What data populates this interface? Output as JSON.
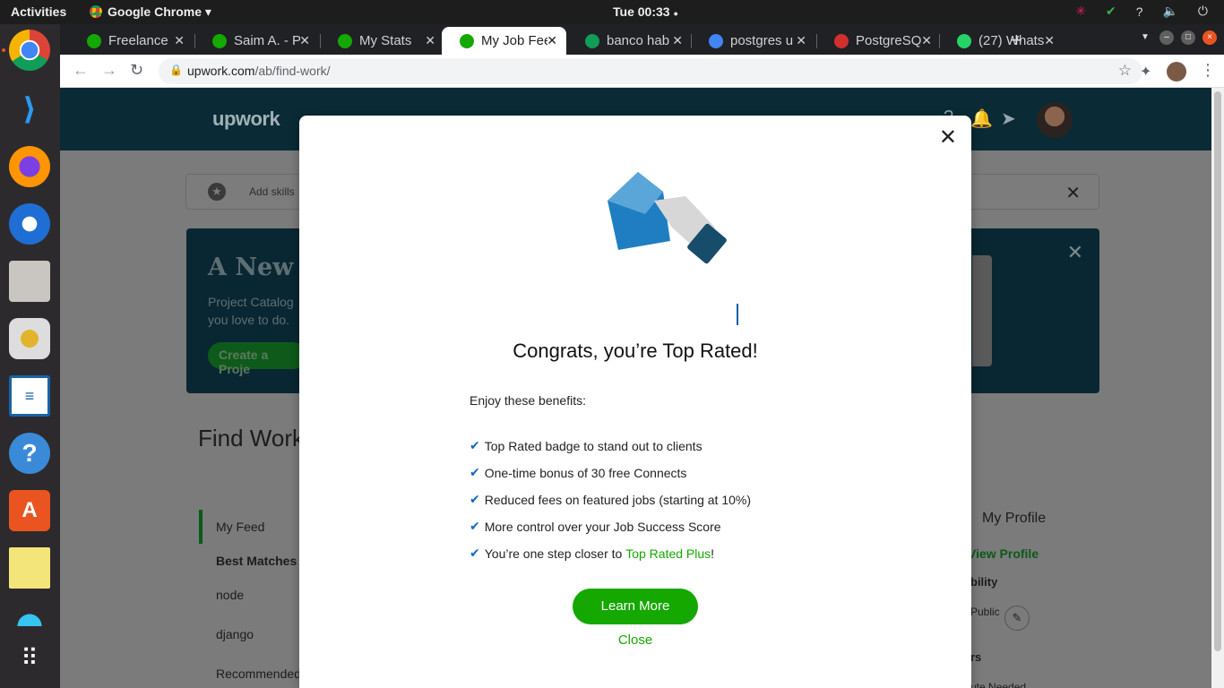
{
  "topbar": {
    "activities": "Activities",
    "app_name": "Google Chrome",
    "clock": "Tue 00:33",
    "tray": [
      "?",
      "🔈",
      "⏻"
    ]
  },
  "browser": {
    "tabs": [
      {
        "label": "Freelance",
        "favicon": "upwork-icon",
        "color": "#14a800",
        "active": false
      },
      {
        "label": "Saim A. - Py",
        "favicon": "upwork-icon",
        "color": "#14a800",
        "active": false
      },
      {
        "label": "My Stats",
        "favicon": "upwork-icon",
        "color": "#14a800",
        "active": false
      },
      {
        "label": "My Job Fee",
        "favicon": "upwork-icon",
        "color": "#14a800",
        "active": true
      },
      {
        "label": "banco hab",
        "favicon": "sheets-icon",
        "color": "#0f9d58",
        "active": false
      },
      {
        "label": "postgres u",
        "favicon": "google-icon",
        "color": "#4285f4",
        "active": false
      },
      {
        "label": "PostgreSQ",
        "favicon": "postgres-icon",
        "color": "#d32f2f",
        "active": false
      },
      {
        "label": "(27) Whats",
        "favicon": "whatsapp-icon",
        "color": "#25d366",
        "active": false
      }
    ],
    "url_host": "upwork.com",
    "url_path": "/ab/find-work/"
  },
  "page": {
    "logo": "upwork",
    "skills_text": "Add skills",
    "banner_title": "A New W",
    "banner_sub": "Project Catalog you love to do.",
    "banner_cta": "Create a Proje",
    "find_work": "Find Work",
    "feed_items": [
      "My Feed",
      "Best Matches",
      "node",
      "django",
      "Recommended"
    ],
    "my_profile": "My Profile",
    "view_profile": "View Profile",
    "visibility": "bility",
    "public": "Public",
    "rs": "rs",
    "needed": "ute Needed"
  },
  "modal": {
    "title": "Congrats, you’re Top Rated!",
    "intro": "Enjoy these benefits:",
    "benefits": [
      "Top Rated badge to stand out to clients",
      "One-time bonus of 30 free Connects",
      "Reduced fees on featured jobs (starting at 10%)",
      "More control over your Job Success Score"
    ],
    "last_benefit_prefix": "You’re one step closer to ",
    "last_benefit_link": "Top Rated Plus",
    "last_benefit_suffix": "!",
    "learn_more": "Learn More",
    "close": "Close"
  }
}
